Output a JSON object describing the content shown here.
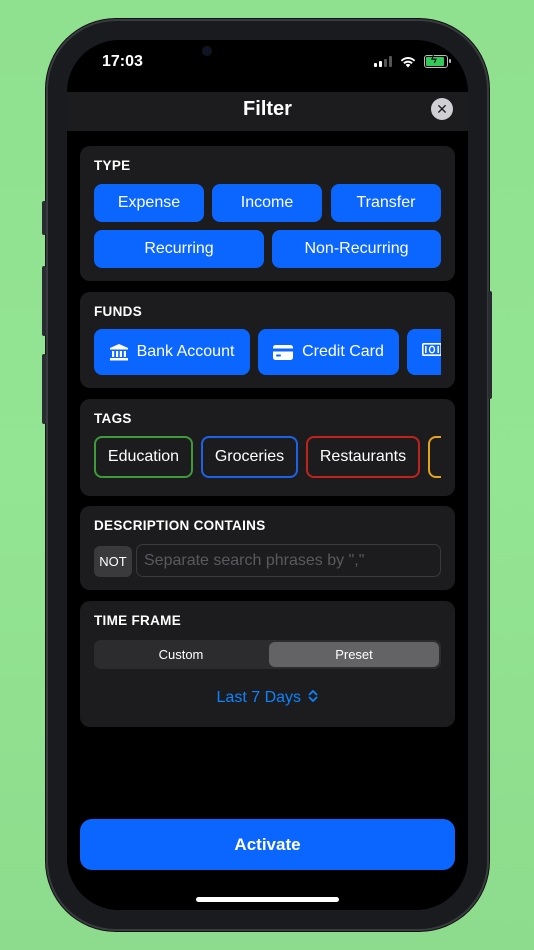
{
  "status_bar": {
    "time": "17:03"
  },
  "sheet": {
    "title": "Filter"
  },
  "type_section": {
    "label": "TYPE",
    "buttons": [
      "Expense",
      "Income",
      "Transfer",
      "Recurring",
      "Non-Recurring"
    ]
  },
  "funds_section": {
    "label": "FUNDS",
    "items": [
      {
        "label": "Bank Account",
        "icon": "bank-icon"
      },
      {
        "label": "Credit Card",
        "icon": "credit-card-icon"
      },
      {
        "label": "",
        "icon": "cash-icon"
      }
    ]
  },
  "tags_section": {
    "label": "TAGS",
    "items": [
      {
        "label": "Education",
        "color": "#3e9b3a"
      },
      {
        "label": "Groceries",
        "color": "#1d63e8"
      },
      {
        "label": "Restaurants",
        "color": "#c1221c"
      },
      {
        "label": "",
        "color": "#e3a31a"
      }
    ]
  },
  "description_section": {
    "label": "DESCRIPTION CONTAINS",
    "not_label": "NOT",
    "placeholder": "Separate search phrases by \",\""
  },
  "timeframe_section": {
    "label": "TIME FRAME",
    "options": [
      "Custom",
      "Preset"
    ],
    "selected": "Preset",
    "preset_value": "Last 7 Days"
  },
  "actions": {
    "activate_label": "Activate"
  },
  "colors": {
    "accent": "#0a66ff",
    "link": "#0a84ff",
    "background": "#92e392"
  }
}
